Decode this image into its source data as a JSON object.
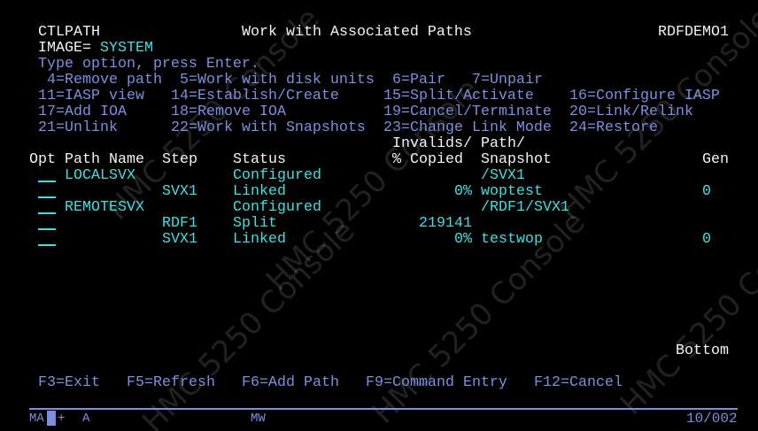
{
  "header": {
    "program": "CTLPATH",
    "title": "Work with Associated Paths",
    "system": "RDFDEMO1",
    "image_label": "IMAGE=",
    "image_value": "SYSTEM"
  },
  "instructions": "Type option, press Enter.",
  "options": [
    " 4=Remove path",
    "5=Work with disk units",
    "6=Pair",
    "7=Unpair",
    "11=IASP view",
    "14=Establish/Create",
    "15=Split/Activate",
    "16=Configure IASP",
    "17=Add IOA",
    "18=Remove IOA",
    "19=Cancel/Terminate",
    "20=Link/Relink",
    "21=Unlink",
    "22=Work with Snapshots",
    "23=Change Link Mode",
    "24=Restore"
  ],
  "columns": {
    "opt": "Opt",
    "path_name": "Path Name",
    "step": "Step",
    "status": "Status",
    "invalids_1": "Invalids/",
    "invalids_2": "% Copied",
    "path_1": "Path/",
    "path_2": "Snapshot",
    "gen": "Gen"
  },
  "rows": [
    {
      "path_name": "LOCALSVX",
      "step": "",
      "status": "Configured",
      "copied": "",
      "snapshot": "/SVX1",
      "gen": ""
    },
    {
      "path_name": "",
      "step": "SVX1",
      "status": "Linked",
      "copied": "0%",
      "snapshot": "woptest",
      "gen": "0"
    },
    {
      "path_name": "REMOTESVX",
      "step": "",
      "status": "Configured",
      "copied": "",
      "snapshot": "/RDF1/SVX1",
      "gen": ""
    },
    {
      "path_name": "",
      "step": "RDF1",
      "status": "Split",
      "copied": "219141",
      "snapshot": "",
      "gen": ""
    },
    {
      "path_name": "",
      "step": "SVX1",
      "status": "Linked",
      "copied": "0%",
      "snapshot": "testwop",
      "gen": "0"
    }
  ],
  "more": "Bottom",
  "function_keys": [
    "F3=Exit",
    "F5=Refresh",
    "F6=Add Path",
    "F9=Command Entry",
    "F12=Cancel"
  ],
  "oia": {
    "mode": "MA",
    "insert": "+",
    "a": "A",
    "mw": "MW",
    "cursor_pos": "10/002"
  },
  "watermark": "HMC 5250 Console"
}
